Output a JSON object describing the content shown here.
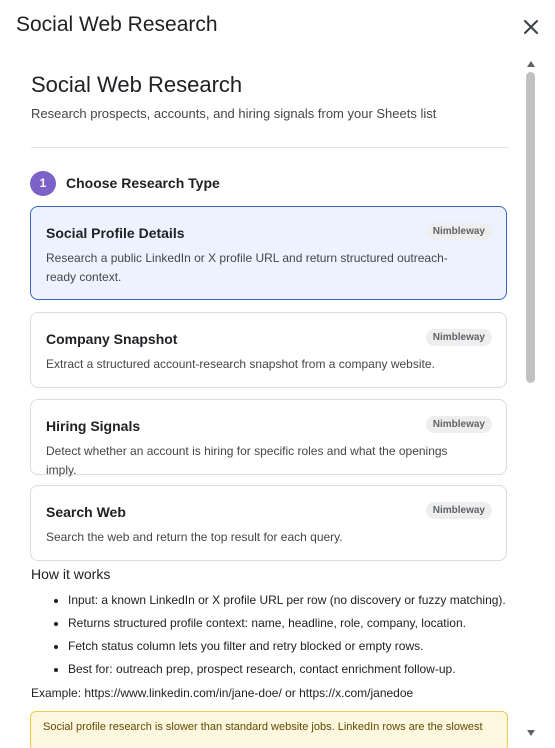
{
  "dialog": {
    "title": "Social Web Research"
  },
  "app": {
    "title": "Social Web Research",
    "subtitle": "Research prospects, accounts, and hiring signals from your Sheets list"
  },
  "step": {
    "number": "1",
    "label": "Choose Research Type"
  },
  "research_types": [
    {
      "title": "Social Profile Details",
      "badge": "Nimbleway",
      "description": "Research a public LinkedIn or X profile URL and return structured outreach-ready context.",
      "selected": true
    },
    {
      "title": "Company Snapshot",
      "badge": "Nimbleway",
      "description": "Extract a structured account-research snapshot from a company website.",
      "selected": false
    },
    {
      "title": "Hiring Signals",
      "badge": "Nimbleway",
      "description": "Detect whether an account is hiring for specific roles and what the openings imply.",
      "selected": false
    },
    {
      "title": "Search Web",
      "badge": "Nimbleway",
      "description": "Search the web and return the top result for each query.",
      "selected": false
    }
  ],
  "how_it_works": {
    "title": "How it works",
    "items": [
      "Input: a known LinkedIn or X profile URL per row (no discovery or fuzzy matching).",
      "Returns structured profile context: name, headline, role, company, location.",
      "Fetch status column lets you filter and retry blocked or empty rows.",
      "Best for: outreach prep, prospect research, contact enrichment follow-up."
    ],
    "example": "Example: https://www.linkedin.com/in/jane-doe/ or https://x.com/janedoe"
  },
  "notice": {
    "text": "Social profile research is slower than standard website jobs. LinkedIn rows are the slowest"
  },
  "colors": {
    "accent": "#7b61c8",
    "selected_border": "#3b63c4",
    "selected_bg": "#edf3fe",
    "notice_bg": "#fef7e0"
  }
}
